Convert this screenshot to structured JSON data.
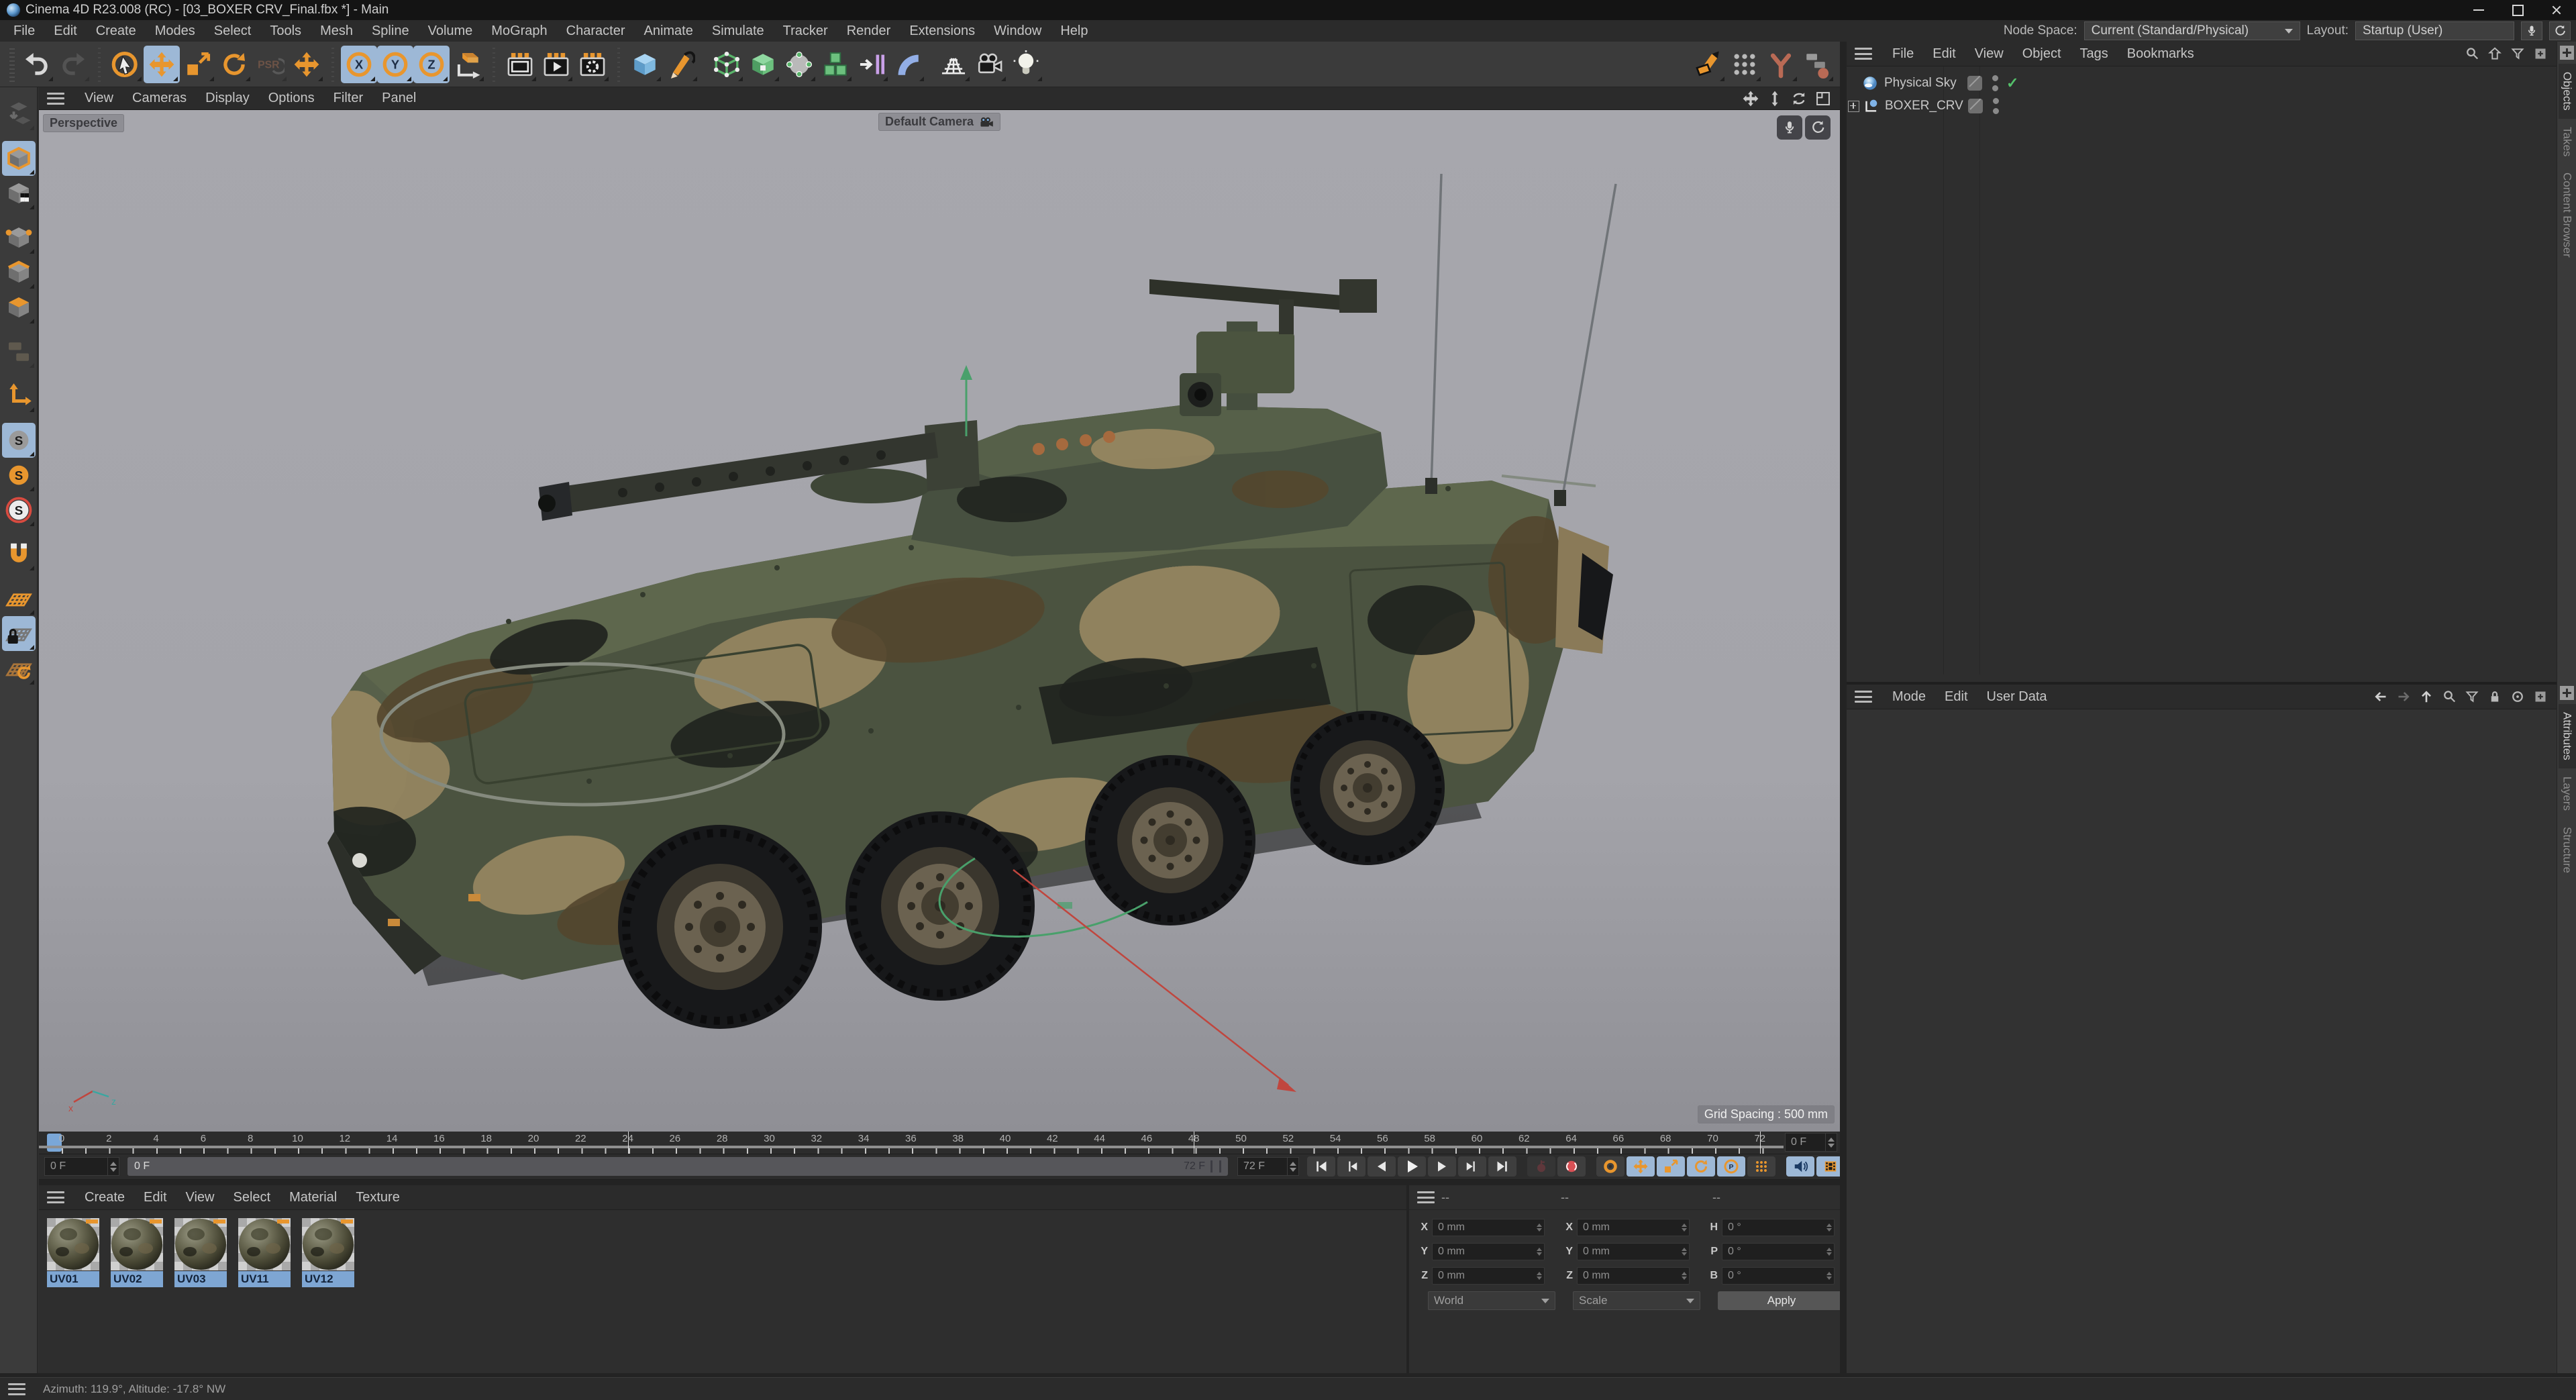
{
  "window": {
    "title": "Cinema 4D R23.008 (RC) - [03_BOXER CRV_Final.fbx *] - Main",
    "menus": [
      "File",
      "Edit",
      "Create",
      "Modes",
      "Select",
      "Tools",
      "Mesh",
      "Spline",
      "Volume",
      "MoGraph",
      "Character",
      "Animate",
      "Simulate",
      "Tracker",
      "Render",
      "Extensions",
      "Window",
      "Help"
    ],
    "node_space_label": "Node Space:",
    "node_space_value": "Current (Standard/Physical)",
    "layout_label": "Layout:",
    "layout_value": "Startup (User)"
  },
  "toolbar": {
    "items": [
      {
        "name": "undo"
      },
      {
        "name": "redo",
        "disabled": true
      },
      {
        "sep": true
      },
      {
        "name": "live-selection"
      },
      {
        "name": "move",
        "active": true
      },
      {
        "name": "scale"
      },
      {
        "name": "rotate"
      },
      {
        "name": "psr",
        "glyph": "PSR",
        "disabled": true
      },
      {
        "name": "last-tool"
      },
      {
        "sep": true
      },
      {
        "name": "lock-x",
        "glyph": "X",
        "active": true
      },
      {
        "name": "lock-y",
        "glyph": "Y",
        "active": true
      },
      {
        "name": "lock-z",
        "glyph": "Z",
        "active": true
      },
      {
        "name": "coord-system"
      },
      {
        "sep": true
      },
      {
        "name": "render-view"
      },
      {
        "name": "render-picture-viewer"
      },
      {
        "name": "render-settings"
      },
      {
        "sep": true
      },
      {
        "name": "primitive-cube"
      },
      {
        "name": "pen"
      },
      {
        "gap": true
      },
      {
        "name": "subdivision-surface"
      },
      {
        "name": "generator"
      },
      {
        "name": "deformer"
      },
      {
        "name": "volume"
      },
      {
        "name": "symmetry"
      },
      {
        "name": "field"
      },
      {
        "gap": true
      },
      {
        "name": "floor"
      },
      {
        "name": "camera"
      },
      {
        "name": "light"
      }
    ],
    "right_items": [
      {
        "name": "pen-polygon"
      },
      {
        "name": "dots-grid"
      },
      {
        "name": "tree-branch"
      },
      {
        "name": "node-graph"
      }
    ]
  },
  "sidebar": {
    "items": [
      {
        "name": "make-editable",
        "disabled": true
      },
      {
        "gap": true
      },
      {
        "name": "model-mode",
        "active": true
      },
      {
        "name": "texture-mode"
      },
      {
        "gap": true
      },
      {
        "name": "point-mode"
      },
      {
        "name": "edge-mode"
      },
      {
        "name": "polygon-mode"
      },
      {
        "gap": true
      },
      {
        "name": "tweak-mode",
        "disabled": true
      },
      {
        "gap": true
      },
      {
        "name": "axis-mode"
      },
      {
        "gap": true
      },
      {
        "name": "snap-toggle",
        "glyph": "S",
        "active": true
      },
      {
        "name": "snap-modes",
        "glyph": "S"
      },
      {
        "name": "snap-3d",
        "glyph": "S"
      },
      {
        "gap": true
      },
      {
        "name": "workplane-magnet"
      },
      {
        "gap": true
      },
      {
        "name": "workplane"
      },
      {
        "name": "workplane-lock",
        "active": true
      },
      {
        "name": "workplane-rotate"
      }
    ]
  },
  "viewport": {
    "menus": [
      "View",
      "Cameras",
      "Display",
      "Options",
      "Filter",
      "Panel"
    ],
    "nav_icons": [
      "pan",
      "zoom-view",
      "rotate-view",
      "toggle-layout"
    ],
    "badge_icons": [
      "capture",
      "sync"
    ],
    "view_label": "Perspective",
    "camera_label": "Default Camera",
    "grid_spacing_label": "Grid Spacing : 500 mm"
  },
  "object_manager": {
    "menus": [
      "File",
      "Edit",
      "View",
      "Object",
      "Tags",
      "Bookmarks"
    ],
    "header_icons": [
      "search",
      "home",
      "filter",
      "add"
    ],
    "objects": [
      {
        "name": "Physical Sky"
      },
      {
        "name": "BOXER_CRV"
      }
    ],
    "tabs": [
      "Objects",
      "Takes",
      "Content Browser"
    ]
  },
  "attribute_manager": {
    "menus": [
      "Mode",
      "Edit",
      "User Data"
    ],
    "header_icons": [
      "back",
      "forward",
      "up",
      "search",
      "filter",
      "lock",
      "target",
      "add"
    ],
    "tabs": [
      "Attributes",
      "Layers",
      "Structure"
    ]
  },
  "timeline": {
    "frames": [
      0,
      2,
      4,
      6,
      8,
      10,
      12,
      14,
      16,
      18,
      20,
      22,
      24,
      26,
      28,
      30,
      32,
      34,
      36,
      38,
      40,
      42,
      44,
      46,
      48,
      50,
      52,
      54,
      56,
      58,
      60,
      62,
      64,
      66,
      68,
      70,
      72
    ],
    "major_every": 24,
    "frame_spinner": "0 F",
    "current_fr2ame": "0 F",
    "current_frame": "0 F",
    "range_start": "0 F",
    "range_end": "72 F",
    "end_spinner": "72 F",
    "transport": [
      {
        "name": "skip-start"
      },
      {
        "name": "prev-key"
      },
      {
        "name": "prev-frame"
      },
      {
        "name": "play"
      },
      {
        "name": "next-frame"
      },
      {
        "name": "next-key"
      },
      {
        "name": "skip-end"
      },
      {
        "gap": true
      },
      {
        "name": "record-key",
        "disabled": true
      },
      {
        "name": "record-keyframe"
      },
      {
        "gap": true
      },
      {
        "name": "autokey"
      },
      {
        "name": "key-position",
        "active": true
      },
      {
        "name": "key-scale",
        "active": true
      },
      {
        "name": "key-rotation",
        "active": true
      },
      {
        "name": "key-parameter",
        "glyph": "P",
        "active": true
      },
      {
        "name": "key-pla"
      },
      {
        "gap": true
      },
      {
        "name": "sound",
        "active": true
      },
      {
        "name": "render-preview",
        "active": true
      }
    ]
  },
  "material_manager": {
    "menus": [
      "Create",
      "Edit",
      "View",
      "Select",
      "Material",
      "Texture"
    ],
    "materials": [
      "UV01",
      "UV02",
      "UV03",
      "UV11",
      "UV12"
    ]
  },
  "coordinates": {
    "headers": [
      "--",
      "--",
      "--"
    ],
    "col1": {
      "rows": [
        {
          "label": "X",
          "value": "0 mm"
        },
        {
          "label": "Y",
          "value": "0 mm"
        },
        {
          "label": "Z",
          "value": "0 mm"
        }
      ],
      "dropdown": "World"
    },
    "col2": {
      "rows": [
        {
          "label": "X",
          "value": "0 mm"
        },
        {
          "label": "Y",
          "value": "0 mm"
        },
        {
          "label": "Z",
          "value": "0 mm"
        }
      ],
      "dropdown": "Scale"
    },
    "col3": {
      "rows": [
        {
          "label": "H",
          "value": "0 °"
        },
        {
          "label": "P",
          "value": "0 °"
        },
        {
          "label": "B",
          "value": "0 °"
        }
      ],
      "apply": "Apply"
    }
  },
  "status_bar": {
    "text": "Azimuth: 119.9°, Altitude: -17.8°  NW"
  },
  "colors": {
    "accent_orange": "#e8962e",
    "active_blue": "#9db8d6",
    "selection_blue": "#7ea6d3",
    "viewport_bg": "#a4a4aa",
    "panel_bg": "#2e2e2e",
    "toolbar_bg": "#3b3b3b",
    "enable_green": "#54c06a",
    "gizmo_green": "#49a06b",
    "gizmo_red": "#c0463e"
  }
}
